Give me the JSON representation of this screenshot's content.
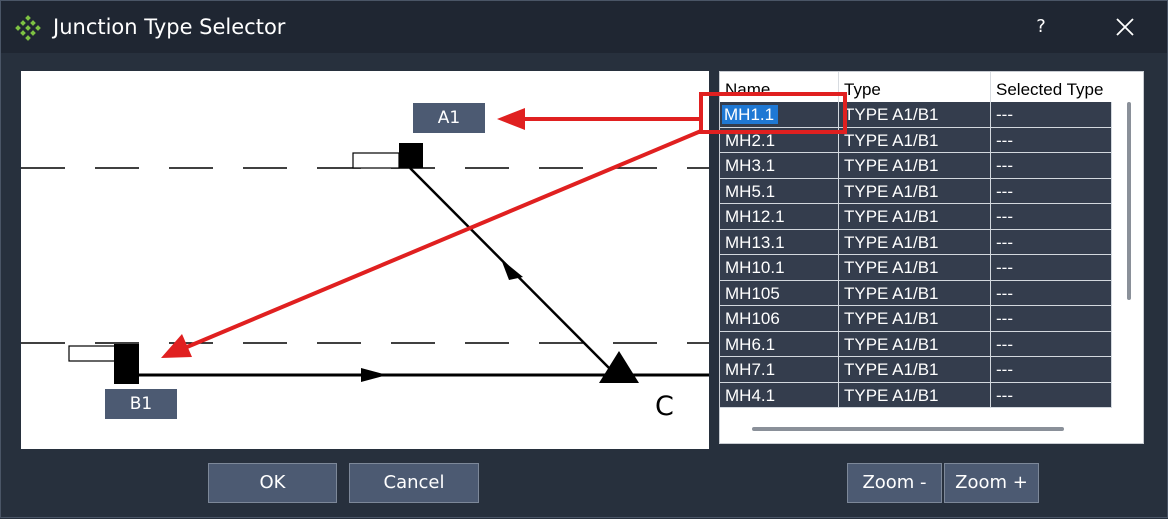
{
  "window": {
    "title": "Junction Type Selector",
    "help_label": "?"
  },
  "diagram": {
    "labels": {
      "a1": "A1",
      "b1": "B1",
      "c": "C"
    }
  },
  "table": {
    "columns": [
      "Name",
      "Type",
      "Selected Type"
    ],
    "rows": [
      {
        "name": "MH1.1",
        "type": "TYPE A1/B1",
        "selected": "---"
      },
      {
        "name": "MH2.1",
        "type": "TYPE A1/B1",
        "selected": "---"
      },
      {
        "name": "MH3.1",
        "type": "TYPE A1/B1",
        "selected": "---"
      },
      {
        "name": "MH5.1",
        "type": "TYPE A1/B1",
        "selected": "---"
      },
      {
        "name": "MH12.1",
        "type": "TYPE A1/B1",
        "selected": "---"
      },
      {
        "name": "MH13.1",
        "type": "TYPE A1/B1",
        "selected": "---"
      },
      {
        "name": "MH10.1",
        "type": "TYPE A1/B1",
        "selected": "---"
      },
      {
        "name": "MH105",
        "type": "TYPE A1/B1",
        "selected": "---"
      },
      {
        "name": "MH106",
        "type": "TYPE A1/B1",
        "selected": "---"
      },
      {
        "name": "MH6.1",
        "type": "TYPE A1/B1",
        "selected": "---"
      },
      {
        "name": "MH7.1",
        "type": "TYPE A1/B1",
        "selected": "---"
      },
      {
        "name": "MH4.1",
        "type": "TYPE A1/B1",
        "selected": "---"
      }
    ],
    "selected_row_index": 0
  },
  "buttons": {
    "ok": "OK",
    "cancel": "Cancel",
    "zoom_out": "Zoom -",
    "zoom_in": "Zoom +"
  },
  "colors": {
    "window_bg": "#27303d",
    "row_bg": "#343d4d",
    "selection": "#1e78d4",
    "annotation": "#e02020",
    "button_bg": "#4c5a72"
  },
  "icons": {
    "app": "green-diamond-grid-icon",
    "close": "close-icon"
  }
}
